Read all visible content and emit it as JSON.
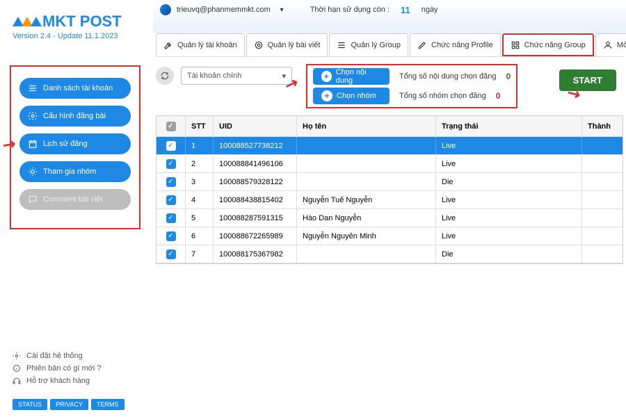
{
  "brand": {
    "name": "MKT POST",
    "version": "Version 2.4 - Update 11.1.2023"
  },
  "header": {
    "email": "trieuvq@phanmemmkt.com",
    "remaining_label": "Thời hạn sử dụng còn :",
    "days": "11",
    "days_unit": "ngày"
  },
  "tabs": {
    "t1": "Quản lý tài khoản",
    "t2": "Quản lý bài viết",
    "t3": "Quản lý Group",
    "t4": "Chức năng Profile",
    "t5": "Chức năng Group",
    "t6": "Mở Checkpoint"
  },
  "sidebar": {
    "b1": "Danh sách tài khoản",
    "b2": "Cấu hình đăng bài",
    "b3": "Lịch sử đăng",
    "b4": "Tham gia nhóm",
    "b5": "Comment bài viết"
  },
  "footer": {
    "f1": "Cài đặt hệ thống",
    "f2": "Phiên bản có gì mới ?",
    "f3": "Hỗ trợ khách hàng",
    "p1": "STATUS",
    "p2": "PRIVACY",
    "p3": "TERMS"
  },
  "controls": {
    "account_combo": "Tài khoản chính",
    "choose_content": "Chọn nội dung",
    "choose_group": "Chọn nhóm",
    "content_count_label": "Tổng số nội dung chọn đăng",
    "group_count_label": "Tổng số nhóm chọn đăng",
    "content_count": "0",
    "group_count": "0",
    "start": "START"
  },
  "grid": {
    "headers": {
      "stt": "STT",
      "uid": "UID",
      "name": "Họ tên",
      "status": "Trạng thái",
      "succ": "Thành"
    },
    "rows": [
      {
        "stt": "1",
        "uid": "100088527738212",
        "name": "",
        "status": "Live",
        "selected": true
      },
      {
        "stt": "2",
        "uid": "100088841496106",
        "name": "",
        "status": "Live"
      },
      {
        "stt": "3",
        "uid": "100088579328122",
        "name": "",
        "status": "Die"
      },
      {
        "stt": "4",
        "uid": "100088438815402",
        "name": "Nguyễn Tuế Nguyễn",
        "status": "Live"
      },
      {
        "stt": "5",
        "uid": "100088287591315",
        "name": "Hào Dan Nguyễn",
        "status": "Live"
      },
      {
        "stt": "6",
        "uid": "100088672265989",
        "name": "Nguyễn Nguyên Minh",
        "status": "Live"
      },
      {
        "stt": "7",
        "uid": "100088175367982",
        "name": "",
        "status": "Die"
      }
    ]
  }
}
